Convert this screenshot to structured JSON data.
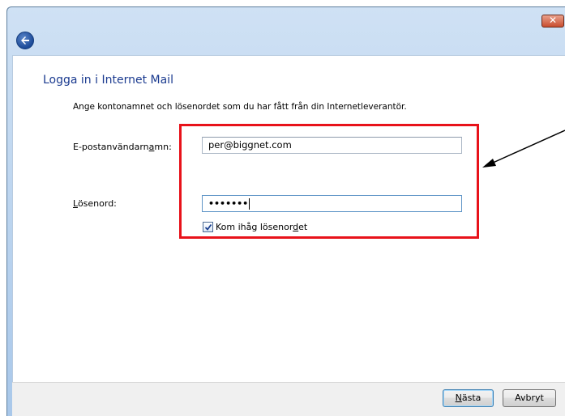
{
  "window": {
    "close_label": "✕"
  },
  "page": {
    "heading": "Logga in i Internet Mail",
    "intro": "Ange kontonamnet och lösenordet som du har fått från din Internetleverantör."
  },
  "form": {
    "username": {
      "label_pre": "E-postanvändarn",
      "label_accel": "a",
      "label_post": "mn:",
      "value": "per@biggnet.com"
    },
    "password": {
      "label_accel": "L",
      "label_post": "ösenord:",
      "value": "•••••••"
    },
    "remember": {
      "label_pre": "Kom ihåg lösenor",
      "label_accel": "d",
      "label_post": "et",
      "checked": true
    }
  },
  "footer": {
    "next_accel": "N",
    "next_post": "ästa",
    "cancel_label": "Avbryt"
  },
  "annotation": {
    "highlight_color": "#e8121a",
    "arrow_color": "#000000"
  }
}
